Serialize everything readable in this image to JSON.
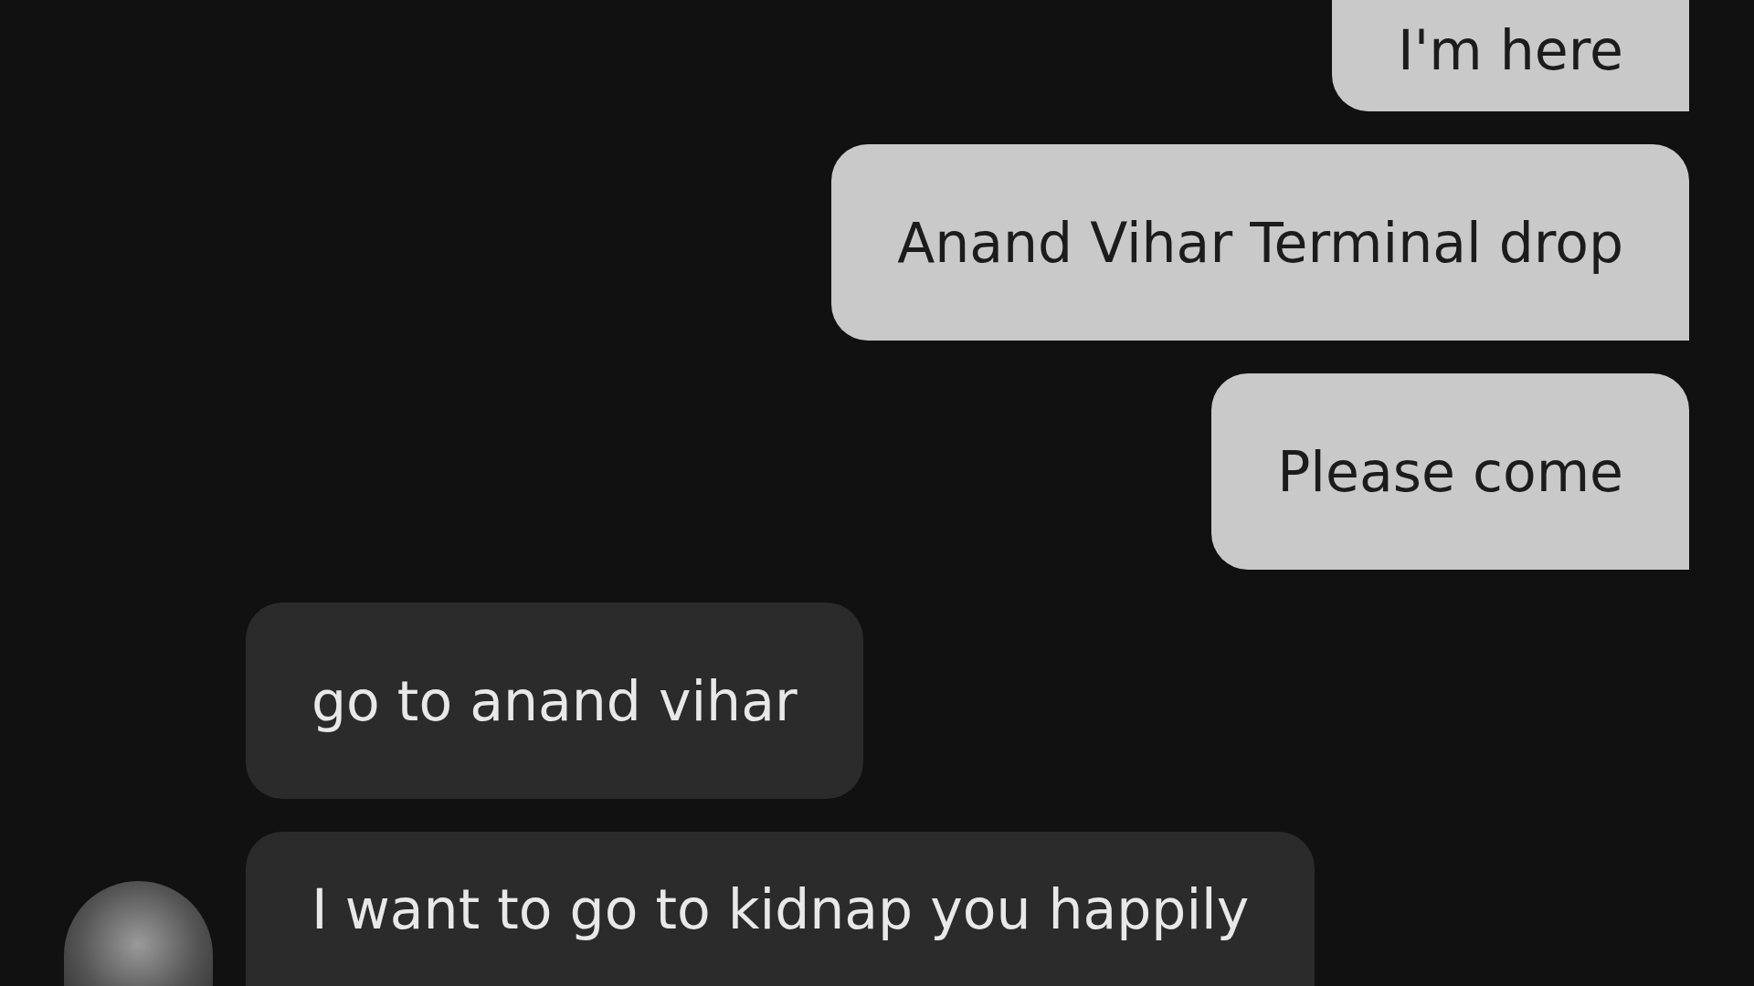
{
  "messages": [
    {
      "kind": "outgoing",
      "text": "I'm here",
      "has_avatar": false
    },
    {
      "kind": "outgoing",
      "text": "Anand Vihar Terminal drop",
      "has_avatar": false
    },
    {
      "kind": "outgoing",
      "text": "Please come",
      "has_avatar": false
    },
    {
      "kind": "incoming",
      "text": "go to anand vihar",
      "has_avatar": false
    },
    {
      "kind": "incoming",
      "text": "I want to go to kidnap you happily",
      "has_avatar": true
    }
  ]
}
